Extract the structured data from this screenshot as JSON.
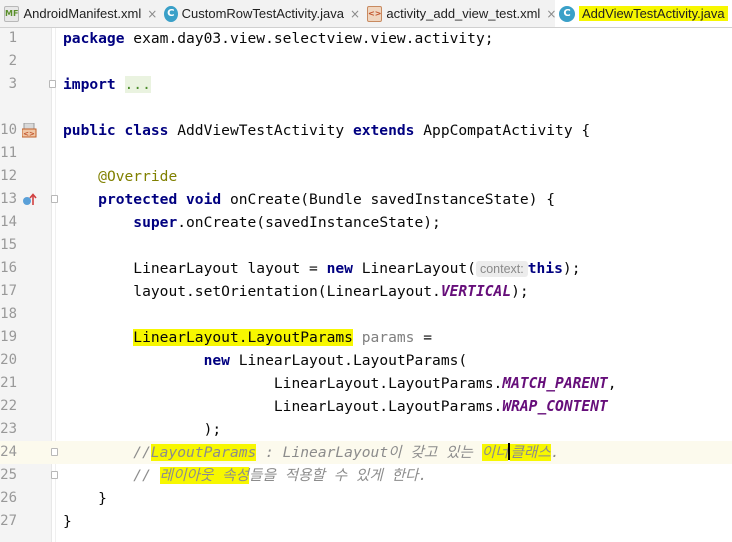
{
  "tabs": [
    {
      "label": "AndroidManifest.xml",
      "icon": "manifest-file-icon",
      "icon_text": "MF"
    },
    {
      "label": "CustomRowTestActivity.java",
      "icon": "java-class-icon",
      "icon_text": "C"
    },
    {
      "label": "activity_add_view_test.xml",
      "icon": "xml-layout-icon",
      "icon_text": "<>"
    },
    {
      "label": "AddViewTestActivity.java",
      "icon": "java-class-icon",
      "icon_text": "C"
    }
  ],
  "active_tab": "AddViewTestActivity.java",
  "editor": {
    "line_numbers": [
      "1",
      "2",
      "3",
      "10",
      "11",
      "12",
      "13",
      "14",
      "15",
      "16",
      "17",
      "18",
      "19",
      "20",
      "21",
      "22",
      "23",
      "24",
      "25",
      "26",
      "27"
    ],
    "code": {
      "l1_kw": "package",
      "l1_rest": " exam.day03.view.selectview.view.activity;",
      "l3_kw": "import",
      "l3_dots": "...",
      "l10_kw1": "public class",
      "l10_name": " AddViewTestActivity ",
      "l10_kw2": "extends",
      "l10_rest": " AppCompatActivity {",
      "l12_ann": "@Override",
      "l13_kw": "protected void",
      "l13_rest": " onCreate(Bundle savedInstanceState) {",
      "l14_kw": "super",
      "l14_rest": ".onCreate(savedInstanceState);",
      "l16_a": "LinearLayout layout = ",
      "l16_kw": "new",
      "l16_b": " LinearLayout(",
      "l16_hint": "context:",
      "l16_kw2": "this",
      "l16_c": ");",
      "l17_a": "layout.setOrientation(LinearLayout.",
      "l17_cst": "VERTICAL",
      "l17_b": ");",
      "l19_hl": "LinearLayout.LayoutParams",
      "l19_gray": " params",
      "l19_rest": " =",
      "l20_kw": "new",
      "l20_rest": " LinearLayout.LayoutParams(",
      "l21_a": "LinearLayout.LayoutParams.",
      "l21_cst": "MATCH_PARENT",
      "l21_b": ",",
      "l22_a": "LinearLayout.LayoutParams.",
      "l22_cst": "WRAP_CONTENT",
      "l23": ");",
      "l24_a": "//",
      "l24_hl": "LayoutParams",
      "l24_b": " : LinearLayout이 갖고 있는 ",
      "l24_hl2a": "이너",
      "l24_hl2b": "클래스",
      "l24_c": ".",
      "l25_a": "// ",
      "l25_hl": "레이아웃 속성",
      "l25_b": "들을 적용할 수 있게 한다.",
      "l26": "}",
      "l27": "}"
    }
  },
  "colors": {
    "keyword": "#000080",
    "annotation": "#808000",
    "constant": "#660e7a",
    "comment": "#8c8c8c",
    "highlight": "#f7f700",
    "caret_line": "#fcfaed"
  }
}
